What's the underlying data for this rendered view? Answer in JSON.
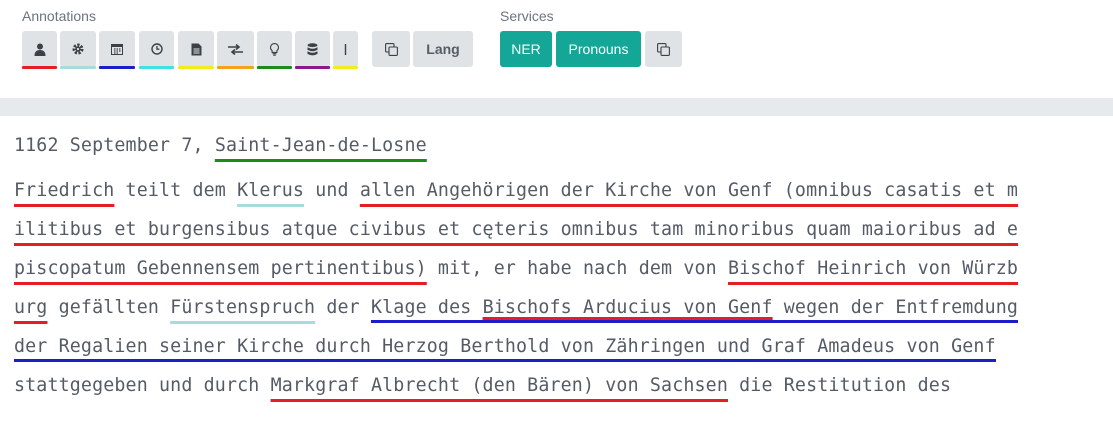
{
  "annotations": {
    "label": "Annotations",
    "buttons": [
      {
        "icon": "person-icon",
        "color": "#e41e26"
      },
      {
        "icon": "gear-icon",
        "color": "#a8dbe0"
      },
      {
        "icon": "calendar-icon",
        "color": "#1d1dc9"
      },
      {
        "icon": "clock-icon",
        "color": "#41e0e8"
      },
      {
        "icon": "document-icon",
        "color": "#f2ec1c"
      },
      {
        "icon": "exchange-icon",
        "color": "#f2a21c"
      },
      {
        "icon": "lightbulb-icon",
        "color": "#1a8c1a"
      },
      {
        "icon": "database-icon",
        "color": "#8a1a8c"
      },
      {
        "icon": "pipe-icon",
        "color": "#f2ec1c"
      }
    ],
    "copy_icon": "copy-icon",
    "lang_label": "Lang"
  },
  "services": {
    "label": "Services",
    "ner_label": "NER",
    "pronouns_label": "Pronouns",
    "copy_icon": "copy-icon",
    "accent": "#14a697"
  },
  "document": {
    "date_place": "1162 September 7, ",
    "place": "Saint-Jean-de-Losne",
    "l1": {
      "a": "Friedrich",
      "b": " teilt dem ",
      "c": "Klerus",
      "d": " und ",
      "e": "allen Angehörigen der Kirche von Genf (omnibus casatis et m"
    },
    "l2": {
      "a": "ilitibus et burgensibus atque civibus et cęteris omnibus tam minoribus quam maioribus ad e"
    },
    "l3": {
      "a": "piscopatum Gebennensem pertinentibus)",
      "b": " mit, er habe nach dem von ",
      "c": "Bischof Heinrich von Würzb"
    },
    "l4": {
      "a": "urg",
      "b": " gefällten ",
      "c": "Fürstenspruch",
      "d": " der ",
      "e1": "Klage des ",
      "e2": "Bischofs Arducius von Genf",
      "e3": " wegen der Entfremdung"
    },
    "l5": {
      "a": "der Regalien seiner Kirche durch Herzog Berthold von Zähringen und Graf Amadeus von Genf"
    },
    "l6": {
      "a": "stattgegeben und durch ",
      "b": "Markgraf Albrecht (den Bären) von Sachsen",
      "c": " die Restitution des"
    }
  }
}
